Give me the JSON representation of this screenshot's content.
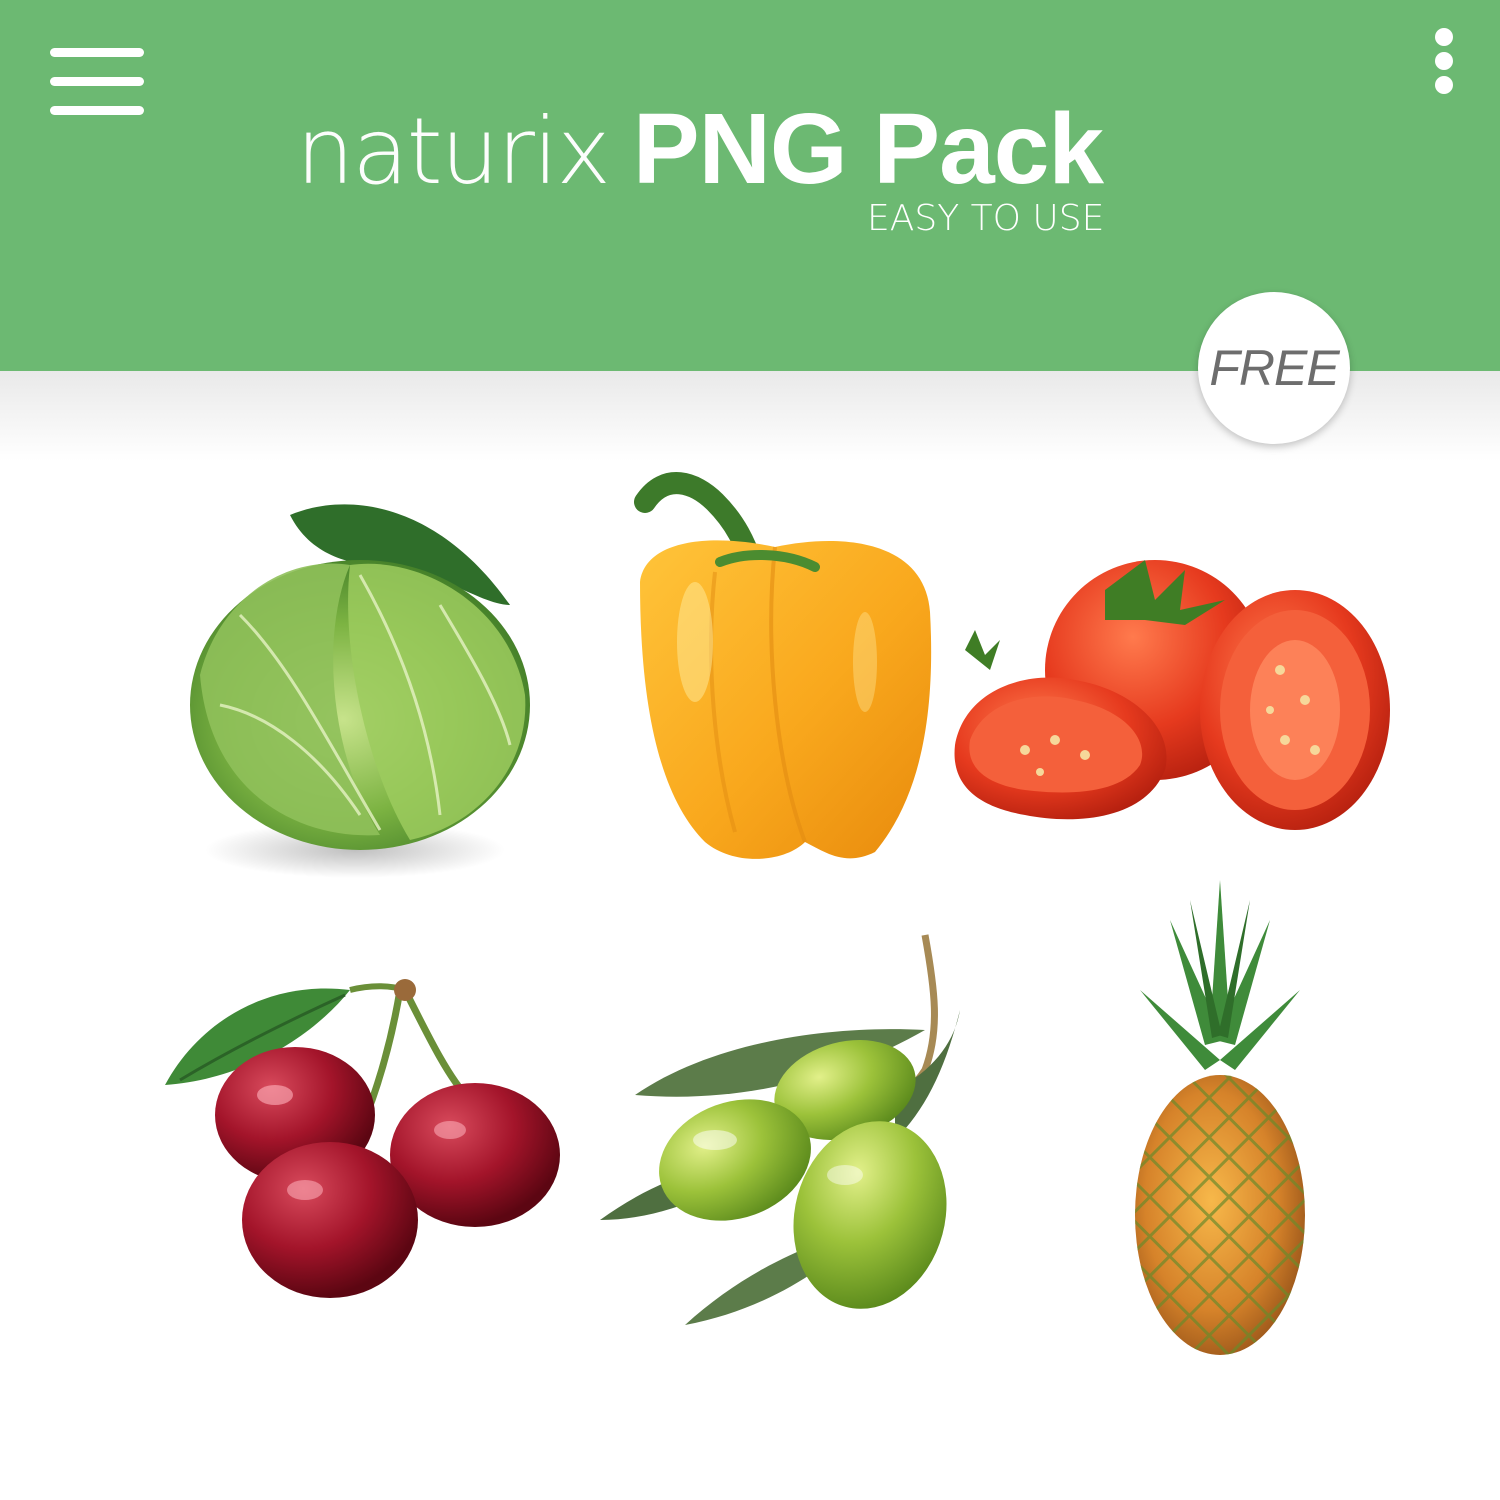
{
  "header": {
    "brand_light": "naturix",
    "brand_bold": "PNG Pack",
    "tagline": "EASY TO USE",
    "background_color": "#6cb972",
    "menu_icon": "hamburger-menu-icon",
    "overflow_icon": "more-vertical-icon"
  },
  "badge": {
    "label": "FREE"
  },
  "gallery": {
    "items": [
      {
        "name": "cabbage"
      },
      {
        "name": "yellow-bell-pepper"
      },
      {
        "name": "tomatoes"
      },
      {
        "name": "cherries"
      },
      {
        "name": "green-olives"
      },
      {
        "name": "pineapple"
      }
    ]
  }
}
